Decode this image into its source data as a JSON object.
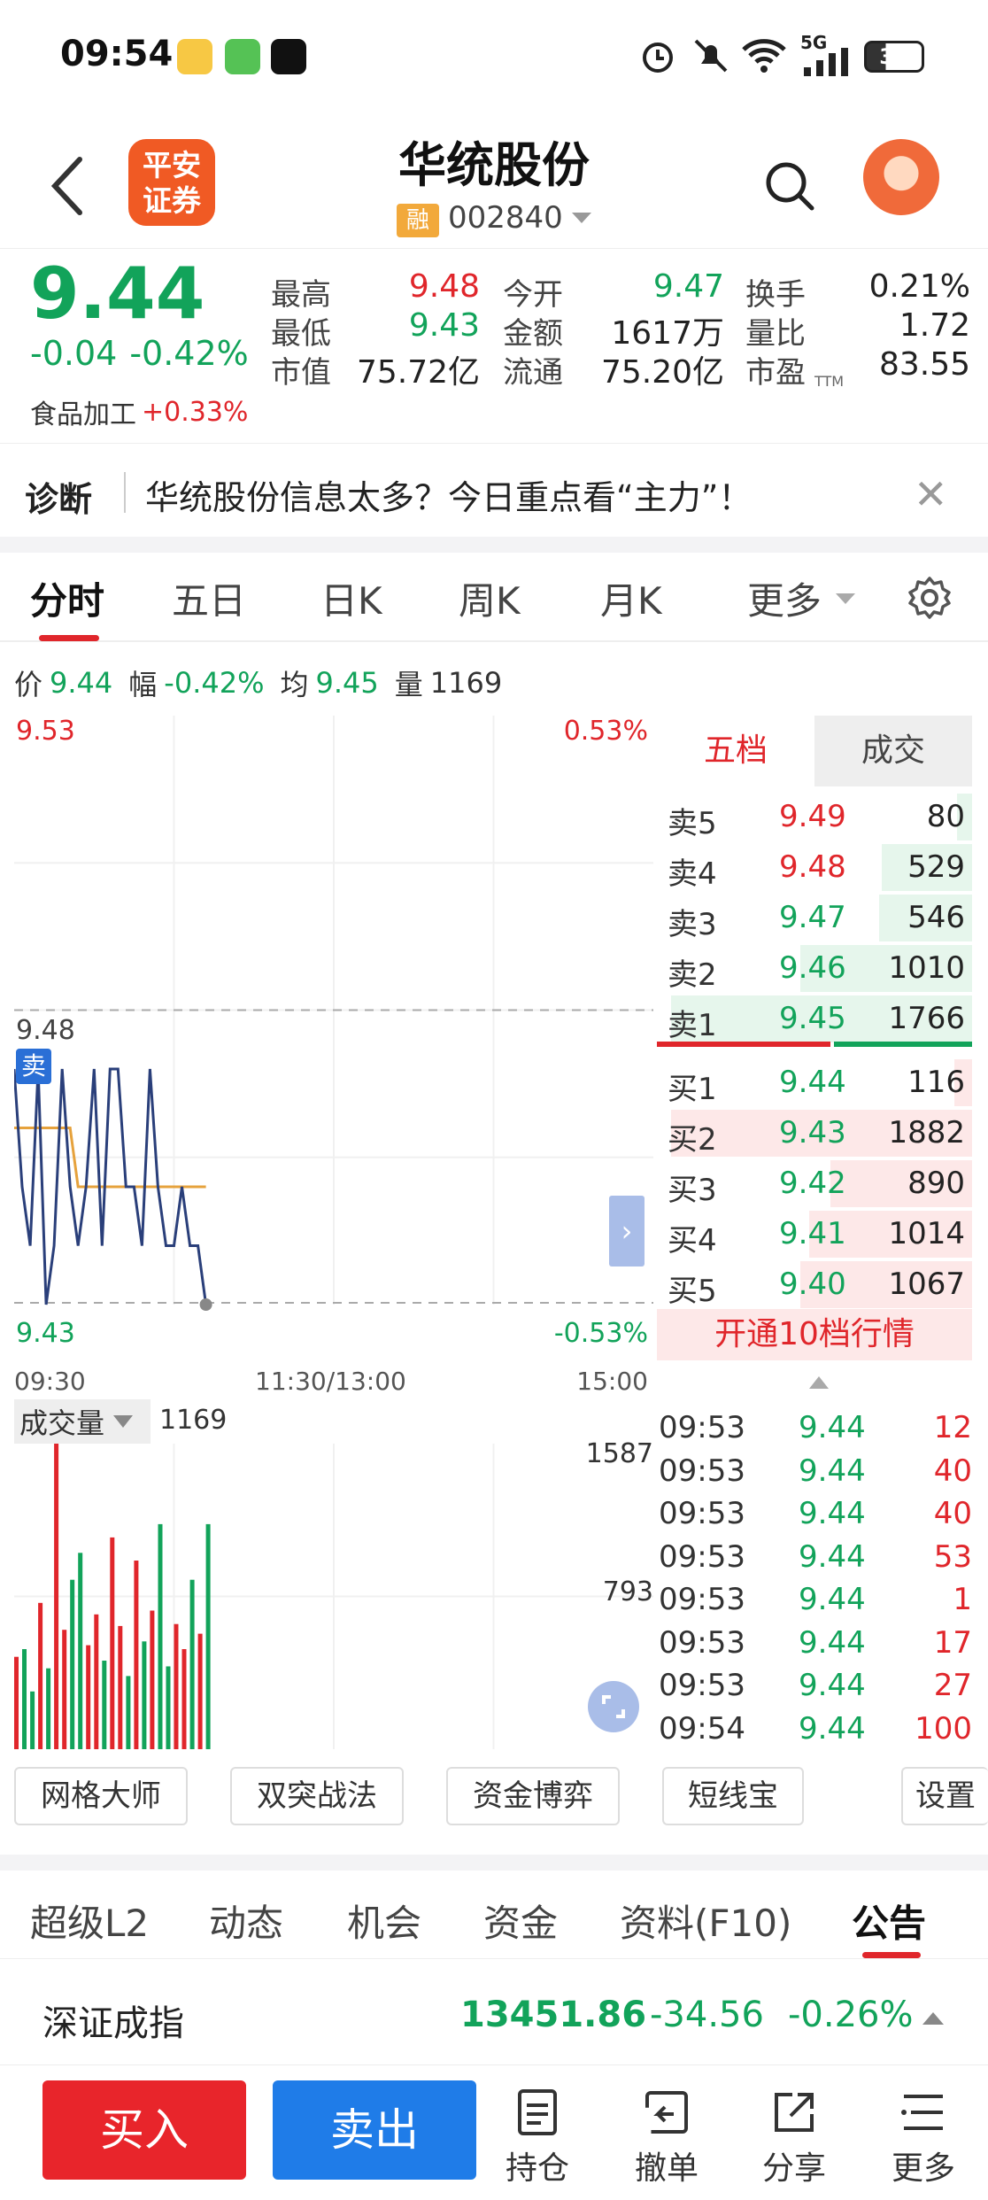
{
  "status": {
    "time": "09:54",
    "battery": "35",
    "network": "5G"
  },
  "header": {
    "broker_logo_line1": "平安",
    "broker_logo_line2": "证券",
    "stock_name": "华统股份",
    "rong_badge": "融",
    "stock_code": "002840"
  },
  "quote": {
    "price": "9.44",
    "change": "-0.04",
    "change_pct": "-0.42%",
    "sector_name": "食品加工",
    "sector_pct": "+0.33%",
    "fields": [
      {
        "label": "最高",
        "value": "9.48",
        "color": "#e0262b"
      },
      {
        "label": "今开",
        "value": "9.47",
        "color": "#12a35a"
      },
      {
        "label": "换手",
        "value": "0.21%",
        "color": "#222222"
      },
      {
        "label": "最低",
        "value": "9.43",
        "color": "#12a35a"
      },
      {
        "label": "金额",
        "value": "1617万",
        "color": "#222222"
      },
      {
        "label": "量比",
        "value": "1.72",
        "color": "#222222"
      },
      {
        "label": "市值",
        "value": "75.72亿",
        "color": "#222222"
      },
      {
        "label": "流通",
        "value": "75.20亿",
        "color": "#222222"
      },
      {
        "label": "市盈",
        "value": "83.55",
        "color": "#222222"
      }
    ],
    "pe_superscript": "TTM"
  },
  "diagnosis": {
    "label": "诊断",
    "text": "华统股份信息太多？今日重点看“主力”！"
  },
  "chart_tabs": [
    "分时",
    "五日",
    "日K",
    "周K",
    "月K",
    "更多"
  ],
  "info_line": {
    "price_label": "价",
    "price": "9.44",
    "range_label": "幅",
    "range": "-0.42%",
    "avg_label": "均",
    "avg": "9.45",
    "vol_label": "量",
    "vol": "1169"
  },
  "chart_labels": {
    "top_price": "9.53",
    "top_pct": "0.53%",
    "mid_price": "9.48",
    "sell_marker": "卖",
    "bottom_price": "9.43",
    "bottom_pct": "-0.53%",
    "time_start": "09:30",
    "time_mid": "11:30/13:00",
    "time_end": "15:00"
  },
  "chart_data": [
    {
      "type": "line",
      "x": [
        "09:30",
        "09:31",
        "09:32",
        "09:33",
        "09:34",
        "09:35",
        "09:36",
        "09:37",
        "09:38",
        "09:39",
        "09:40",
        "09:41",
        "09:42",
        "09:43",
        "09:44",
        "09:45",
        "09:46",
        "09:47",
        "09:48",
        "09:49",
        "09:50",
        "09:51",
        "09:52",
        "09:53",
        "09:54"
      ],
      "series": [
        {
          "values": [
            9.47,
            9.45,
            9.44,
            9.47,
            9.43,
            9.44,
            9.47,
            9.45,
            9.44,
            9.45,
            9.47,
            9.44,
            9.47,
            9.47,
            9.45,
            9.45,
            9.44,
            9.47,
            9.45,
            9.44,
            9.44,
            9.45,
            9.44,
            9.44,
            9.43
          ]
        },
        {
          "values": [
            9.46,
            9.46,
            9.46,
            9.46,
            9.46,
            9.46,
            9.46,
            9.46,
            9.45,
            9.45,
            9.45,
            9.45,
            9.45,
            9.45,
            9.45,
            9.45,
            9.45,
            9.45,
            9.45,
            9.45,
            9.45,
            9.45,
            9.45,
            9.45,
            9.45
          ]
        }
      ],
      "ylim": [
        9.43,
        9.53
      ],
      "grid": true
    },
    {
      "type": "bar",
      "title": "成交量",
      "categories": [
        "09:30",
        "09:31",
        "09:32",
        "09:33",
        "09:34",
        "09:35",
        "09:36",
        "09:37",
        "09:38",
        "09:39",
        "09:40",
        "09:41",
        "09:42",
        "09:43",
        "09:44",
        "09:45",
        "09:46",
        "09:47",
        "09:48",
        "09:49",
        "09:50",
        "09:51",
        "09:52",
        "09:53",
        "09:54"
      ],
      "values": [
        480,
        520,
        300,
        760,
        420,
        1587,
        620,
        880,
        1020,
        540,
        700,
        460,
        1100,
        640,
        380,
        980,
        560,
        720,
        1169,
        430,
        650,
        520,
        880,
        600,
        1169
      ],
      "ylim": [
        0,
        1587
      ],
      "ticks": [
        "1587",
        "793"
      ]
    }
  ],
  "volume_panel": {
    "label": "成交量",
    "value": "1169",
    "tick_top": "1587",
    "tick_mid": "793"
  },
  "order_book": {
    "tab_active": "五档",
    "tab_other": "成交",
    "sells": [
      {
        "label": "卖5",
        "price": "9.49",
        "vol": "80",
        "color": "#e0262b",
        "vol_frac": 0.05
      },
      {
        "label": "卖4",
        "price": "9.48",
        "vol": "529",
        "color": "#e0262b",
        "vol_frac": 0.3
      },
      {
        "label": "卖3",
        "price": "9.47",
        "vol": "546",
        "color": "#12a35a",
        "vol_frac": 0.31
      },
      {
        "label": "卖2",
        "price": "9.46",
        "vol": "1010",
        "color": "#12a35a",
        "vol_frac": 0.57
      },
      {
        "label": "卖1",
        "price": "9.45",
        "vol": "1766",
        "color": "#12a35a",
        "vol_frac": 1.0
      }
    ],
    "buys": [
      {
        "label": "买1",
        "price": "9.44",
        "vol": "116",
        "color": "#12a35a",
        "vol_frac": 0.06
      },
      {
        "label": "买2",
        "price": "9.43",
        "vol": "1882",
        "color": "#12a35a",
        "vol_frac": 1.0
      },
      {
        "label": "买3",
        "price": "9.42",
        "vol": "890",
        "color": "#12a35a",
        "vol_frac": 0.47
      },
      {
        "label": "买4",
        "price": "9.41",
        "vol": "1014",
        "color": "#12a35a",
        "vol_frac": 0.54
      },
      {
        "label": "买5",
        "price": "9.40",
        "vol": "1067",
        "color": "#12a35a",
        "vol_frac": 0.57
      }
    ],
    "upgrade_text": "开通10档行情"
  },
  "trades": [
    {
      "time": "09:53",
      "price": "9.44",
      "vol": "12"
    },
    {
      "time": "09:53",
      "price": "9.44",
      "vol": "40"
    },
    {
      "time": "09:53",
      "price": "9.44",
      "vol": "40"
    },
    {
      "time": "09:53",
      "price": "9.44",
      "vol": "53"
    },
    {
      "time": "09:53",
      "price": "9.44",
      "vol": "1"
    },
    {
      "time": "09:53",
      "price": "9.44",
      "vol": "17"
    },
    {
      "time": "09:53",
      "price": "9.44",
      "vol": "27"
    },
    {
      "time": "09:54",
      "price": "9.44",
      "vol": "100"
    }
  ],
  "tools": [
    "网格大师",
    "双突战法",
    "资金博弈",
    "短线宝",
    "设置"
  ],
  "info_tabs": [
    "超级L2",
    "动态",
    "机会",
    "资金",
    "资料(F10)",
    "公告"
  ],
  "index": {
    "name": "深证成指",
    "value": "13451.86",
    "change": "-34.56",
    "pct": "-0.26%"
  },
  "bottom_nav": {
    "buy": "买入",
    "sell": "卖出",
    "items": [
      "持仓",
      "撤单",
      "分享",
      "更多"
    ]
  },
  "colors": {
    "up": "#e0262b",
    "down": "#12a35a",
    "price_line": "#2a3f7a",
    "avg_line": "#e6a23c",
    "buy_button": "#e8252b",
    "sell_button": "#1f7ce8"
  }
}
